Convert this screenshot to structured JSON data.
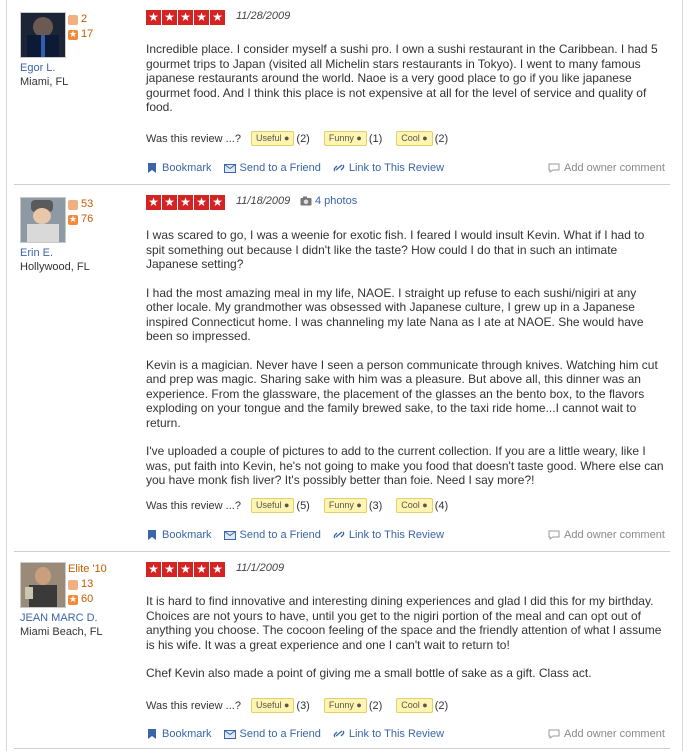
{
  "labels": {
    "was_this_review": "Was this review ...?",
    "useful": "Useful",
    "funny": "Funny",
    "cool": "Cool",
    "bookmark": "Bookmark",
    "send_to_friend": "Send to a Friend",
    "link_to_review": "Link to This Review",
    "add_owner_comment": "Add owner comment"
  },
  "reviews": [
    {
      "user": "Egor L.",
      "location": "Miami, FL",
      "elite": "",
      "friends": "2",
      "review_count": "17",
      "rating": 5,
      "date": "11/28/2009",
      "photos": "",
      "paragraphs": [
        "Incredible place. I consider myself a sushi pro. I own a sushi restaurant in the Caribbean. I had 5 gourmet trips to Japan (visited all Michelin stars restaurants in Tokyo). I went to many famous japanese restaurants around the world. Naoe is a very good place to go if you like japanese gourmet food. And I think this place is not expensive at all for the level of service and quality of food."
      ],
      "useful": "(2)",
      "funny": "(1)",
      "cool": "(2)"
    },
    {
      "user": "Erin E.",
      "location": "Hollywood, FL",
      "elite": "",
      "friends": "53",
      "review_count": "76",
      "rating": 5,
      "date": "11/18/2009",
      "photos": "4 photos",
      "paragraphs": [
        "I was scared to go, I was a weenie for exotic fish. I feared I would insult Kevin. What if I had to spit something out because I didn't like the taste? How could I do that in such an intimate Japanese setting?",
        "I had the most amazing meal in my life, NAOE. I straight up refuse to each sushi/nigiri at any other locale. My grandmother was obsessed with Japanese culture, I grew up in a Japanese inspired Connecticut home. I was channeling my late Nana as I ate at NAOE. She would have been so impressed.",
        "Kevin is a magician. Never have I seen a person communicate through knives. Watching him cut and prep was magic. Sharing sake with him was a pleasure. But above all, this dinner was an experience. From the glassware, the placement of the glasses an the bento box, to the flavors exploding on your tongue and the family brewed sake, to the taxi ride home...I cannot wait to return.",
        "I've uploaded a couple of pictures to add to the current collection. If you are a little weary, like I was, put faith into Kevin, he's not going to make you food that doesn't taste good. Where else can you have monk fish liver? It's possibly better than foie. Need I say more?!"
      ],
      "useful": "(5)",
      "funny": "(3)",
      "cool": "(4)"
    },
    {
      "user": "JEAN MARC D.",
      "location": "Miami Beach, FL",
      "elite": "Elite '10",
      "friends": "13",
      "review_count": "60",
      "rating": 5,
      "date": "11/1/2009",
      "photos": "",
      "paragraphs": [
        "It is hard to find innovative and interesting dining experiences and glad I did this for my birthday. Choices are not yours to have, until you get to the nigiri portion of the meal and can opt out of anything you choose. The cocoon feeling of the space and the friendly attention of what I assume is his wife. It was a great experience and one I can't wait to return to!",
        "Chef Kevin also made a point of giving me a small bottle of sake as a gift. Class act."
      ],
      "useful": "(3)",
      "funny": "(2)",
      "cool": "(2)"
    }
  ]
}
